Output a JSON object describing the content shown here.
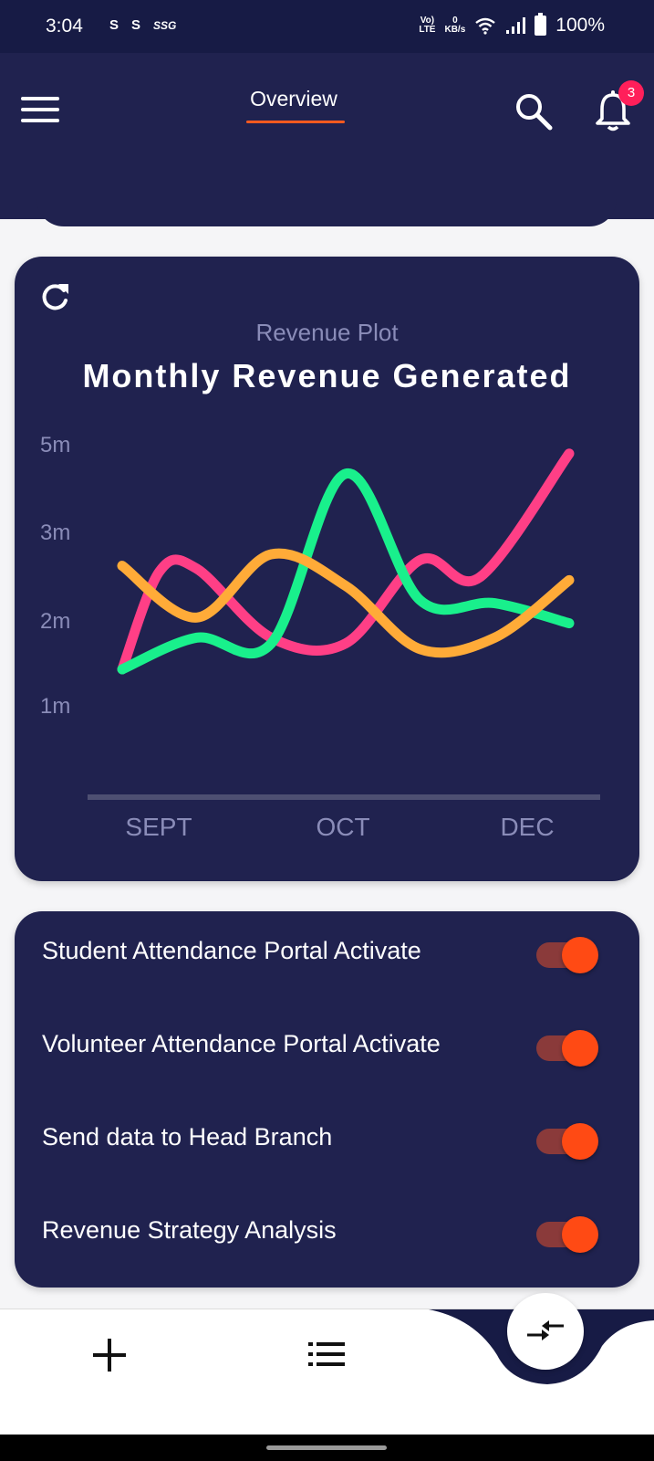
{
  "status_bar": {
    "time": "3:04",
    "notification_labels": [
      "S",
      "S",
      "SSG"
    ],
    "network_top": "Vo)",
    "network_bottom": "LTE",
    "speed_value": "0",
    "speed_unit": "KB/s",
    "battery": "100%"
  },
  "header": {
    "tab_label": "Overview",
    "notification_count": "3",
    "accent_color": "#ff5a1f"
  },
  "chart_card": {
    "subtitle": "Revenue Plot",
    "title": "Monthly Revenue Generated"
  },
  "chart_data": {
    "type": "line",
    "subtitle": "Revenue Plot",
    "title": "Monthly Revenue Generated",
    "y_tick_labels": [
      "5m",
      "3m",
      "2m",
      "1m"
    ],
    "x_tick_labels": [
      "SEPT",
      "OCT",
      "DEC"
    ],
    "x_range": [
      0,
      6
    ],
    "y_range": [
      0,
      5
    ],
    "grid": false,
    "legend": "none",
    "series": [
      {
        "color": "#ff3f86",
        "points": [
          [
            0,
            1.0
          ],
          [
            0.5,
            2.7
          ],
          [
            1.0,
            2.75
          ],
          [
            2.0,
            1.55
          ],
          [
            3.0,
            1.45
          ],
          [
            4.0,
            2.9
          ],
          [
            4.8,
            2.6
          ],
          [
            6.0,
            4.75
          ]
        ]
      },
      {
        "color": "#19f08c",
        "points": [
          [
            0,
            1.0
          ],
          [
            1.0,
            1.55
          ],
          [
            2.0,
            1.45
          ],
          [
            3.0,
            4.4
          ],
          [
            4.0,
            2.2
          ],
          [
            5.0,
            2.15
          ],
          [
            6.0,
            1.8
          ]
        ]
      },
      {
        "color": "#ffab38",
        "points": [
          [
            0,
            2.8
          ],
          [
            1.0,
            1.9
          ],
          [
            2.0,
            3.0
          ],
          [
            3.0,
            2.45
          ],
          [
            4.0,
            1.35
          ],
          [
            5.0,
            1.55
          ],
          [
            6.0,
            2.55
          ]
        ]
      }
    ]
  },
  "toggles": [
    {
      "label": "Student Attendance Portal Activate",
      "on": true
    },
    {
      "label": "Volunteer Attendance Portal Activate",
      "on": true
    },
    {
      "label": "Send data to Head Branch",
      "on": true
    },
    {
      "label": "Revenue Strategy Analysis",
      "on": true
    }
  ],
  "bottom_nav": {
    "icons": [
      "add-icon",
      "list-icon",
      "compress-arrows-icon"
    ]
  }
}
